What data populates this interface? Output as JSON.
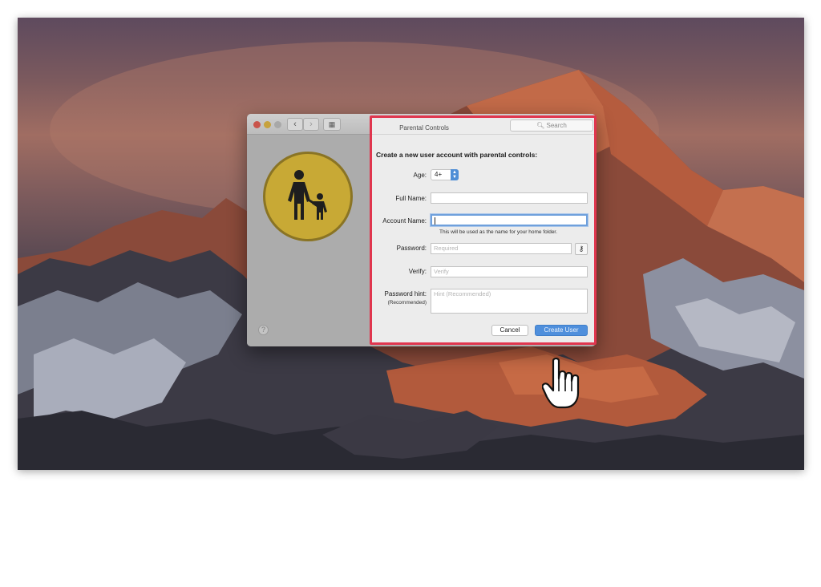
{
  "window": {
    "title": "Parental Controls",
    "search_placeholder": "Search"
  },
  "icons": [
    "back-chevron-icon",
    "forward-chevron-icon",
    "grid-icon",
    "parent-child-icon",
    "search-icon",
    "key-icon",
    "help-icon",
    "hand-pointer-icon"
  ],
  "sheet": {
    "heading": "Create a new user account with parental controls:",
    "age_label": "Age:",
    "age_value": "4+",
    "full_name_label": "Full Name:",
    "full_name_value": "",
    "account_name_label": "Account Name:",
    "account_name_value": "",
    "account_name_note": "This will be used as the name for your home folder.",
    "password_label": "Password:",
    "password_placeholder": "Required",
    "verify_label": "Verify:",
    "verify_placeholder": "Verify",
    "hint_label": "Password hint:",
    "hint_sublabel": "(Recommended)",
    "hint_placeholder": "Hint (Recommended)",
    "cancel_label": "Cancel",
    "create_label": "Create User"
  },
  "colors": {
    "highlight_border": "#e0364e",
    "accent_blue": "#4f8fdc",
    "badge_gold": "#c8a935"
  }
}
